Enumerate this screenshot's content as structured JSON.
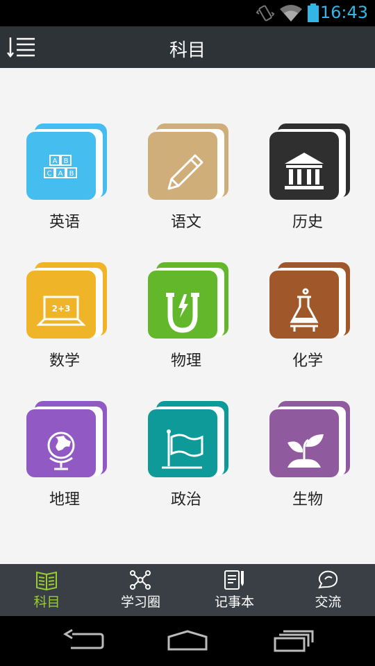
{
  "status_bar": {
    "time": "16:43",
    "icons": [
      "vibrate-icon",
      "wifi-icon",
      "battery-icon"
    ],
    "accent": "#33b5e5"
  },
  "header": {
    "title": "科目",
    "menu_icon": "menu-list-icon",
    "background": "#2e3338"
  },
  "subjects": [
    {
      "label": "英语",
      "icon": "abc-blocks-icon",
      "color": "#46bdef"
    },
    {
      "label": "语文",
      "icon": "pencil-icon",
      "color": "#cfae79"
    },
    {
      "label": "历史",
      "icon": "museum-icon",
      "color": "#2f2f2f"
    },
    {
      "label": "数学",
      "icon": "laptop-math-icon",
      "color": "#f0b429"
    },
    {
      "label": "物理",
      "icon": "magnet-icon",
      "color": "#63b72a"
    },
    {
      "label": "化学",
      "icon": "flask-icon",
      "color": "#a0582a"
    },
    {
      "label": "地理",
      "icon": "globe-icon",
      "color": "#9159c4"
    },
    {
      "label": "政治",
      "icon": "flag-icon",
      "color": "#0f9a9a"
    },
    {
      "label": "生物",
      "icon": "sprout-icon",
      "color": "#8f5a9e"
    }
  ],
  "book_glyph_text": {
    "blocks": [
      "A",
      "B",
      "C",
      "A",
      "B",
      "C"
    ],
    "math": "2+3"
  },
  "tabs": [
    {
      "label": "科目",
      "icon": "book-icon",
      "active": true
    },
    {
      "label": "学习圈",
      "icon": "network-icon",
      "active": false
    },
    {
      "label": "记事本",
      "icon": "notebook-icon",
      "active": false
    },
    {
      "label": "交流",
      "icon": "chat-bubble-icon",
      "active": false
    }
  ],
  "tab_active_color": "#9acd32",
  "nav": {
    "icons": [
      "back-icon",
      "home-icon",
      "recent-apps-icon"
    ]
  }
}
